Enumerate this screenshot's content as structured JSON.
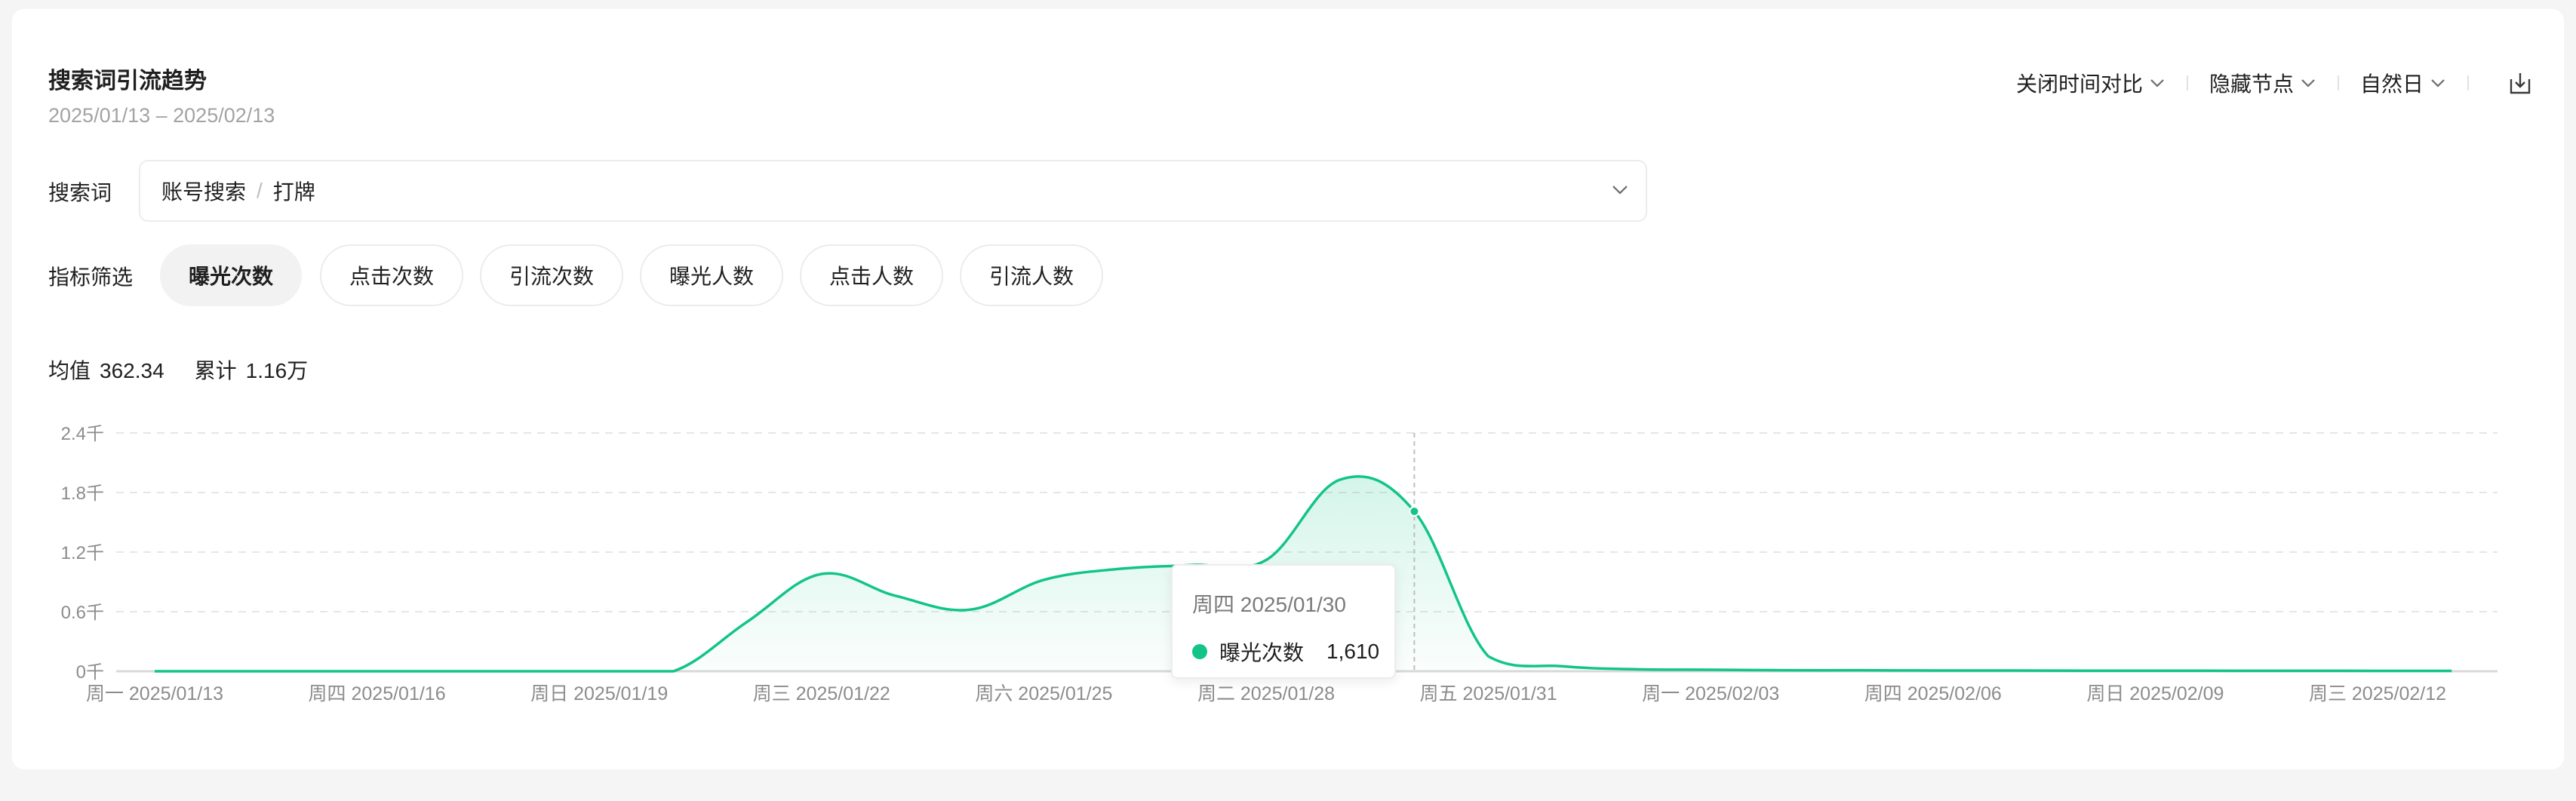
{
  "header": {
    "title": "搜索词引流趋势",
    "date_range": "2025/01/13 – 2025/02/13"
  },
  "toolbar": {
    "compare_label": "关闭时间对比",
    "nodes_label": "隐藏节点",
    "granularity_label": "自然日",
    "export_icon": "export-icon"
  },
  "filters": {
    "search_label": "搜索词",
    "search_path": [
      "账号搜索",
      "打牌"
    ],
    "metric_label": "指标筛选",
    "metrics": [
      "曝光次数",
      "点击次数",
      "引流次数",
      "曝光人数",
      "点击人数",
      "引流人数"
    ],
    "active_metric": "曝光次数"
  },
  "stats": {
    "avg_label": "均值",
    "avg_value": "362.34",
    "total_label": "累计",
    "total_value": "1.16万"
  },
  "colors": {
    "accent": "#12c48a",
    "grid": "#e6e6e6",
    "axis_text": "#8c8c8c"
  },
  "tooltip": {
    "date": "周四 2025/01/30",
    "series_name": "曝光次数",
    "value": "1,610"
  },
  "chart_data": {
    "type": "area",
    "x_tick_labels": [
      "周一 2025/01/13",
      "周四 2025/01/16",
      "周日 2025/01/19",
      "周三 2025/01/22",
      "周六 2025/01/25",
      "周二 2025/01/28",
      "周五 2025/01/31",
      "周一 2025/02/03",
      "周四 2025/02/06",
      "周日 2025/02/09",
      "周三 2025/02/12"
    ],
    "y_tick_labels": [
      "0千",
      "0.6千",
      "1.2千",
      "1.8千",
      "2.4千"
    ],
    "ylim": [
      0,
      2400
    ],
    "grid": true,
    "x": [
      "2025/01/13",
      "2025/01/14",
      "2025/01/15",
      "2025/01/16",
      "2025/01/17",
      "2025/01/18",
      "2025/01/19",
      "2025/01/20",
      "2025/01/21",
      "2025/01/22",
      "2025/01/23",
      "2025/01/24",
      "2025/01/25",
      "2025/01/26",
      "2025/01/27",
      "2025/01/28",
      "2025/01/29",
      "2025/01/30",
      "2025/01/31",
      "2025/02/01",
      "2025/02/02",
      "2025/02/03",
      "2025/02/04",
      "2025/02/05",
      "2025/02/06",
      "2025/02/07",
      "2025/02/08",
      "2025/02/09",
      "2025/02/10",
      "2025/02/11",
      "2025/02/12",
      "2025/02/13"
    ],
    "series": [
      {
        "name": "曝光次数",
        "values": [
          0,
          0,
          0,
          0,
          0,
          0,
          0,
          0,
          500,
          980,
          760,
          620,
          920,
          1030,
          1070,
          1120,
          1930,
          1610,
          150,
          50,
          20,
          15,
          10,
          10,
          8,
          8,
          6,
          6,
          5,
          5,
          4,
          4
        ]
      }
    ],
    "highlight_index": 17
  }
}
